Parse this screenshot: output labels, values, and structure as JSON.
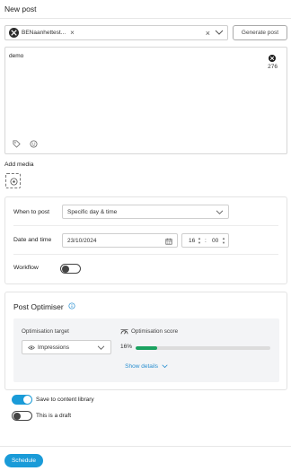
{
  "header": {
    "title": "New post"
  },
  "accounts": {
    "selected": [
      {
        "name": "BENaanhettest...",
        "icon": "x-logo-icon"
      }
    ],
    "clear_icon": "close-icon",
    "dropdown_icon": "chevron-down-icon"
  },
  "generate_button": {
    "label": "Generate post"
  },
  "editor": {
    "content": "demo",
    "network_icon": "x-logo-icon",
    "char_count": "276",
    "tools": [
      "tag-icon",
      "emoji-icon"
    ]
  },
  "media": {
    "label": "Add media",
    "add_icon": "add-media-icon"
  },
  "scheduling": {
    "when_label": "When to post",
    "when_value": "Specific day & time",
    "date_label": "Date and time",
    "date_value": "23/10/2024",
    "hour": "16",
    "minute": "00",
    "workflow_label": "Workflow",
    "workflow_on": false
  },
  "optimiser": {
    "title": "Post Optimiser",
    "target_label": "Optimisation target",
    "target_value": "Impressions",
    "score_label": "Optimisation score",
    "score_text": "16%",
    "score_fraction": 0.16,
    "score_color": "#1aa260",
    "show_details": "Show details"
  },
  "options": {
    "save_library_label": "Save to content library",
    "save_library_on": true,
    "draft_label": "This is a draft",
    "draft_on": false
  },
  "footer": {
    "schedule_label": "Schedule"
  },
  "colors": {
    "accent": "#1a9bd8",
    "link": "#2a8fd0"
  }
}
